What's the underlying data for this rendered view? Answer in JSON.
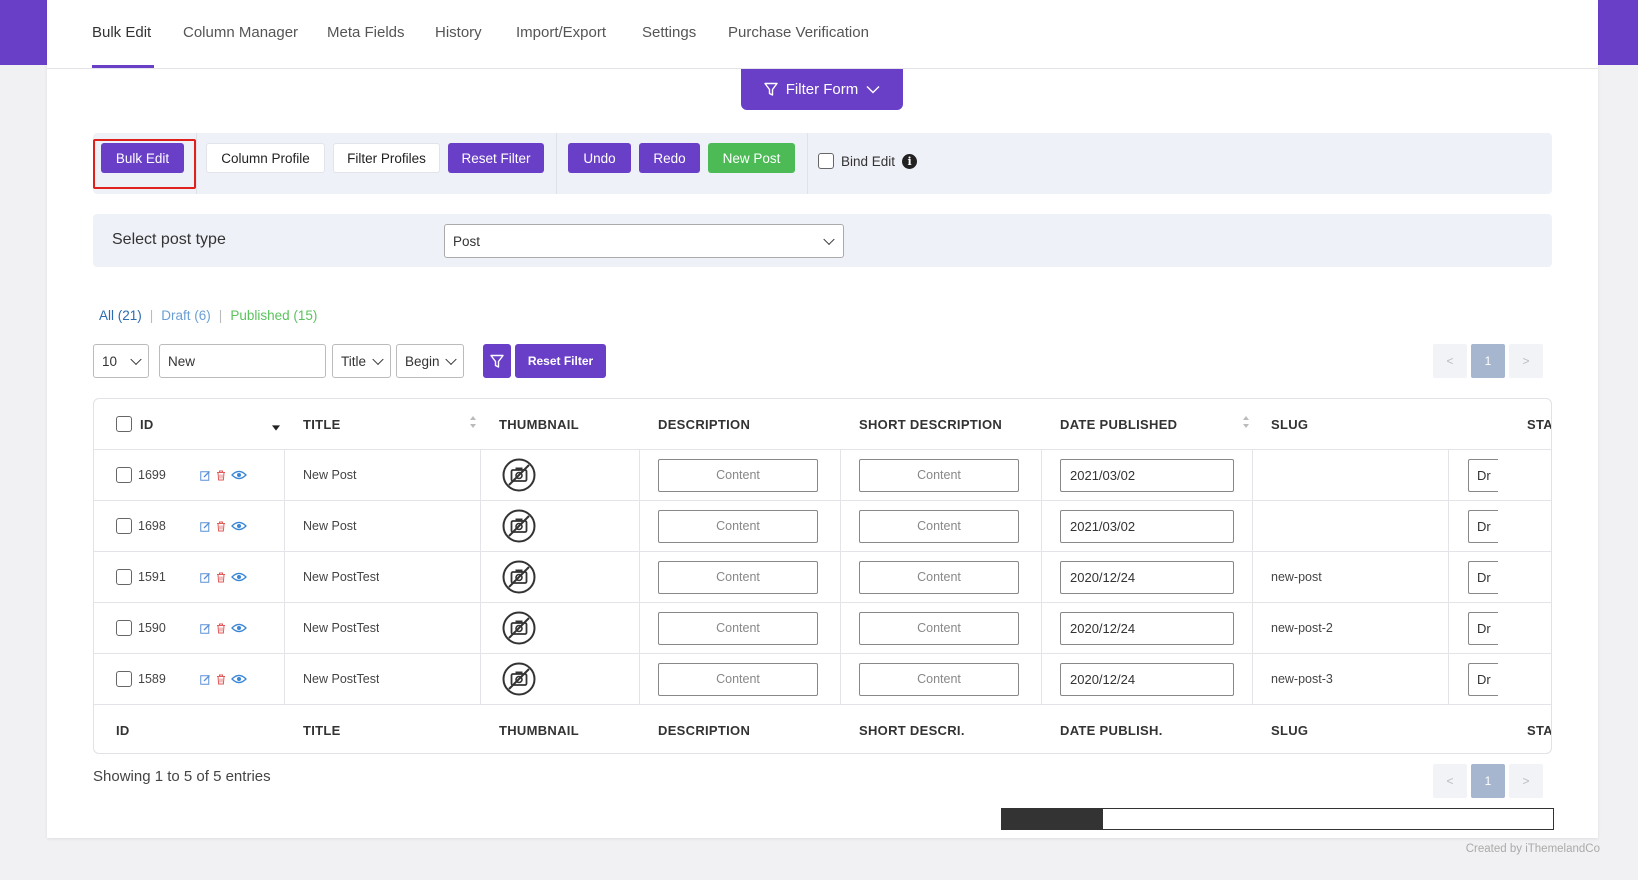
{
  "nav": {
    "tabs": [
      {
        "label": "Bulk Edit"
      },
      {
        "label": "Column Manager"
      },
      {
        "label": "Meta Fields"
      },
      {
        "label": "History"
      },
      {
        "label": "Import/Export"
      },
      {
        "label": "Settings"
      },
      {
        "label": "Purchase Verification"
      }
    ],
    "filter_form": "Filter Form"
  },
  "toolbar": {
    "bulk_edit": "Bulk Edit",
    "column_profile": "Column Profile",
    "filter_profiles": "Filter Profiles",
    "reset_filter": "Reset Filter",
    "undo": "Undo",
    "redo": "Redo",
    "new_post": "New Post",
    "bind_edit": "Bind Edit",
    "info_glyph": "i"
  },
  "post_type": {
    "label": "Select post type",
    "selected": "Post"
  },
  "statuses": {
    "all": "All (21)",
    "draft": "Draft (6)",
    "published": "Published (15)",
    "separator": "|"
  },
  "controls": {
    "per_page": "10",
    "search_value": "New",
    "field": "Title",
    "match": "Begin",
    "reset_filter": "Reset Filter"
  },
  "pagination": {
    "prev": "<",
    "current": "1",
    "next": ">"
  },
  "table": {
    "header": {
      "id": "ID",
      "title": "TITLE",
      "thumbnail": "THUMBNAIL",
      "description": "DESCRIPTION",
      "short_description": "SHORT DESCRIPTION",
      "date_published": "DATE PUBLISHED",
      "slug": "SLUG",
      "status": "STA"
    },
    "footer": {
      "id": "ID",
      "title": "TITLE",
      "thumbnail": "THUMBNAIL",
      "description": "DESCRIPTION",
      "short_description": "SHORT DESCRI.",
      "date_published": "DATE PUBLISH.",
      "slug": "SLUG",
      "status": "STA"
    },
    "rows": [
      {
        "id": "1699",
        "title": "New Post",
        "description": "Content",
        "short_description": "Content",
        "date": "2021/03/02",
        "slug": "",
        "status": "Dr"
      },
      {
        "id": "1698",
        "title": "New Post",
        "description": "Content",
        "short_description": "Content",
        "date": "2021/03/02",
        "slug": "",
        "status": "Dr"
      },
      {
        "id": "1591",
        "title": "New PostTest",
        "description": "Content",
        "short_description": "Content",
        "date": "2020/12/24",
        "slug": "new-post",
        "status": "Dr"
      },
      {
        "id": "1590",
        "title": "New PostTest",
        "description": "Content",
        "short_description": "Content",
        "date": "2020/12/24",
        "slug": "new-post-2",
        "status": "Dr"
      },
      {
        "id": "1589",
        "title": "New PostTest",
        "description": "Content",
        "short_description": "Content",
        "date": "2020/12/24",
        "slug": "new-post-3",
        "status": "Dr"
      }
    ]
  },
  "showing": "Showing 1 to 5 of 5 entries",
  "credit": "Created by iThemelandCo",
  "colors": {
    "accent": "#6a3fc8",
    "success": "#4cbb55",
    "highlight": "#e0201b"
  }
}
